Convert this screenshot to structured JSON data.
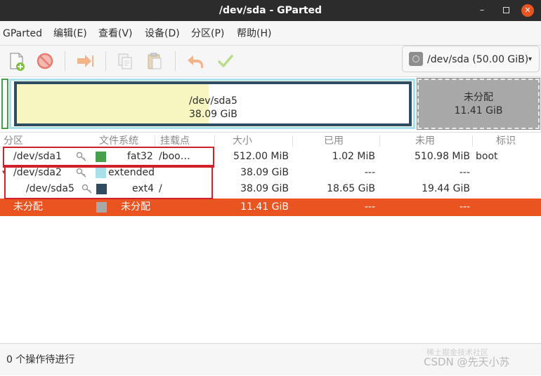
{
  "window": {
    "title": "/dev/sda - GParted",
    "minimize_glyph": "–",
    "close_glyph": "✕"
  },
  "menubar": {
    "items": [
      "GParted",
      "编辑(E)",
      "查看(V)",
      "设备(D)",
      "分区(P)",
      "帮助(H)"
    ]
  },
  "toolbar": {
    "buttons": [
      "new-partition-icon",
      "delete-icon",
      "resize-move-icon",
      "copy-icon",
      "paste-icon",
      "undo-icon",
      "apply-icon"
    ],
    "device_selector": {
      "label": "/dev/sda (50.00 GiB)",
      "arrow": "▾"
    }
  },
  "diskmap": {
    "sda5": {
      "name": "/dev/sda5",
      "size": "38.09 GiB",
      "used_fraction": 0.49
    },
    "unallocated": {
      "name": "未分配",
      "size": "11.41 GiB"
    }
  },
  "table": {
    "headers": [
      "分区",
      "文件系统",
      "挂载点",
      "大小",
      "已用",
      "未用",
      "标识"
    ],
    "rows": [
      {
        "partition": "/dev/sda1",
        "filesystem": "fat32",
        "mount": "/boo…",
        "size": "512.00 MiB",
        "used": "1.02 MiB",
        "unused": "510.98 MiB",
        "flags": "boot",
        "color": "#4aa04a"
      },
      {
        "partition": "/dev/sda2",
        "filesystem": "extended",
        "mount": "",
        "size": "38.09 GiB",
        "used": "---",
        "unused": "---",
        "flags": "",
        "color": "#a8e0ea",
        "expander": "▾"
      },
      {
        "partition": "/dev/sda5",
        "filesystem": "ext4",
        "mount": "/",
        "size": "38.09 GiB",
        "used": "18.65 GiB",
        "unused": "19.44 GiB",
        "flags": "",
        "color": "#2f4c63"
      },
      {
        "partition": "未分配",
        "filesystem": "未分配",
        "mount": "",
        "size": "11.41 GiB",
        "used": "---",
        "unused": "---",
        "flags": "",
        "color": "#a8a8a8"
      }
    ]
  },
  "statusbar": {
    "text": "0 个操作待进行"
  },
  "watermark": {
    "line1": "稀土掘金技术社区",
    "line2": "CSDN @先天小苏"
  }
}
